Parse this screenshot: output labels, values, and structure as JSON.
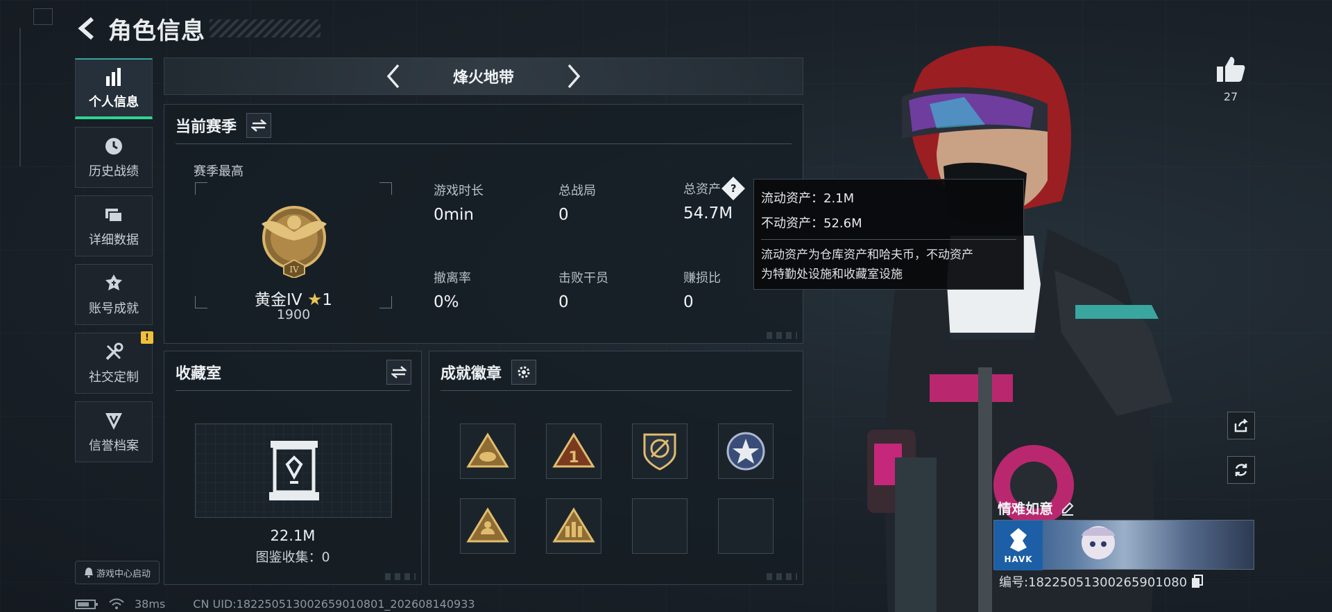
{
  "header": {
    "title": "角色信息"
  },
  "sidebar": {
    "items": [
      {
        "label": "个人信息",
        "icon": "bar-chart-icon",
        "active": true
      },
      {
        "label": "历史战绩",
        "icon": "clock-icon"
      },
      {
        "label": "详细数据",
        "icon": "folder-icon"
      },
      {
        "label": "账号成就",
        "icon": "medal-icon"
      },
      {
        "label": "社交定制",
        "icon": "tools-icon",
        "badge": "!"
      },
      {
        "label": "信誉档案",
        "icon": "shield-emblem-icon"
      }
    ],
    "game_center": "游戏中心启动"
  },
  "mode": {
    "title": "烽火地带"
  },
  "season": {
    "title": "当前赛季",
    "best_label": "赛季最高",
    "rank_name": "黄金IV",
    "rank_stars": "1",
    "rank_score": "1900",
    "stats": [
      {
        "label": "游戏时长",
        "value": "0min"
      },
      {
        "label": "总战局",
        "value": "0"
      },
      {
        "label": "总资产",
        "value": "54.7M",
        "help": "?"
      },
      {
        "label": "撤离率",
        "value": "0%"
      },
      {
        "label": "击败干员",
        "value": "0"
      },
      {
        "label": "赚损比",
        "value": "0"
      }
    ]
  },
  "tooltip": {
    "liquid": "流动资产：2.1M",
    "fixed": "不动资产：52.6M",
    "desc_line1": "流动资产为仓库资产和哈夫币，不动资产",
    "desc_line2": "为特勤处设施和收藏室设施"
  },
  "collection": {
    "title": "收藏室",
    "value": "22.1M",
    "count": "图鉴收集：0"
  },
  "badges": {
    "title": "成就徽章",
    "slots": 8,
    "filled": 6
  },
  "profile": {
    "likes": "27",
    "nickname": "情难如意",
    "card_brand": "HAVK",
    "number_line": "编号:18225051300265901080"
  },
  "status_bar": {
    "ping": "38ms",
    "uid": "CN UID:18225051300265901080​1_202608140933"
  },
  "colors": {
    "accent": "#2fd58e",
    "gold": "#c9a45a",
    "warn": "#f0c03a"
  }
}
